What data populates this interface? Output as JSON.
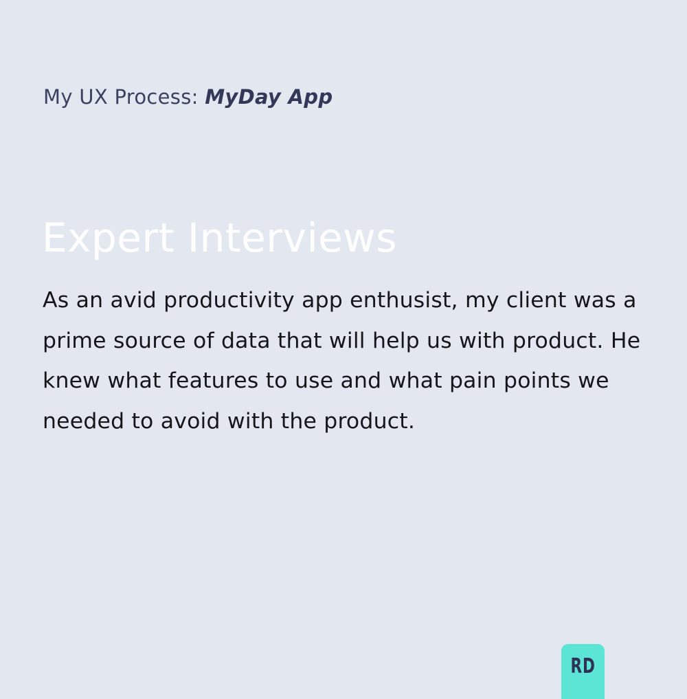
{
  "header": {
    "prefix": "My UX Process: ",
    "project": "MyDay App"
  },
  "section": {
    "title": "Expert Interviews",
    "body": "As an avid productivity app enthusist, my client was a prime source of data that will help us with product. He knew what features to use and what pain points we needed to avoid with the product."
  },
  "logo": {
    "text": "RD",
    "background": "#5ce4d4",
    "color": "#2f3154"
  }
}
